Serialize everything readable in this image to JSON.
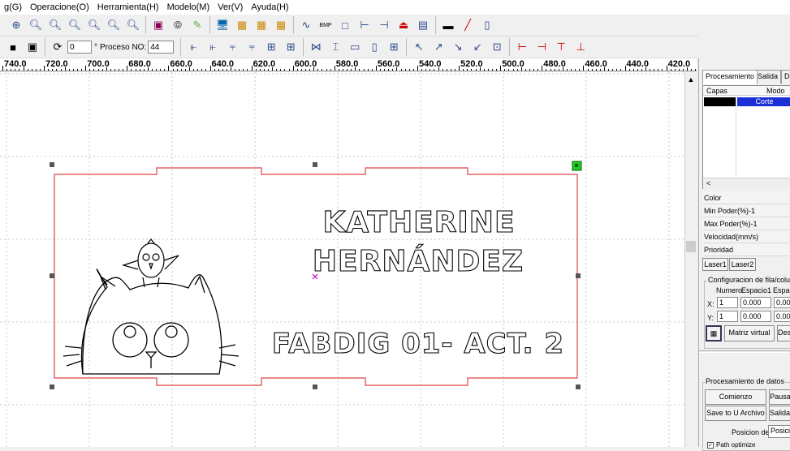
{
  "menu": [
    "g(G)",
    "Operacione(O)",
    "Herramienta(H)",
    "Modelo(M)",
    "Ver(V)",
    "Ayuda(H)"
  ],
  "toolbar2": {
    "rotation_value": "0",
    "degree_symbol": "°",
    "proceso_label": "Proceso NO:",
    "proceso_value": "44"
  },
  "toolbar1": {
    "bmp_label": "BMP"
  },
  "ruler_labels": [
    "740.0",
    "720.0",
    "700.0",
    "680.0",
    "660.0",
    "640.0",
    "620.0",
    "600.0",
    "580.0",
    "560.0",
    "540.0",
    "520.0",
    "500.0",
    "480.0",
    "460.0",
    "440.0",
    "420.0"
  ],
  "design": {
    "line1": "KATHERINE",
    "line2": "HERNÁNDEZ",
    "line3": "FABDIG 01- ACT. 2"
  },
  "panel": {
    "tabs": [
      "Procesamiento",
      "Salida",
      "D"
    ],
    "layers_headers": [
      "Capas",
      "Modo"
    ],
    "layer_mode": "Corte",
    "scroll_left": "<",
    "props": [
      "Color",
      "Min Poder(%)-1",
      "Max Poder(%)-1",
      "Velocidad(mm/s)",
      "Prioridad"
    ],
    "laser_tabs": [
      "Laser1",
      "Laser2"
    ],
    "config_title": "Configuracion de fila/columna",
    "col_numero": "Numero",
    "col_espacio1": "Espacio1",
    "col_espacio2": "Espac",
    "x_label": "X:",
    "x_num": "1",
    "x_space": "0.000",
    "x_space2": "0.00",
    "y_label": "Y:",
    "y_num": "1",
    "y_space": "0.000",
    "y_space2": "0.00",
    "matriz_btn": "Matriz virtual",
    "des_btn": "Des",
    "data_title": "Procesamiento de datos",
    "comienzo_btn": "Comienzo",
    "pausa_btn": "Pausa",
    "save_u_btn": "Save to U Archivo",
    "salida_btn": "Salida d",
    "posicion_label": "Posicion de",
    "posicion_value": "Posicio",
    "path_label": "Path optimize"
  }
}
